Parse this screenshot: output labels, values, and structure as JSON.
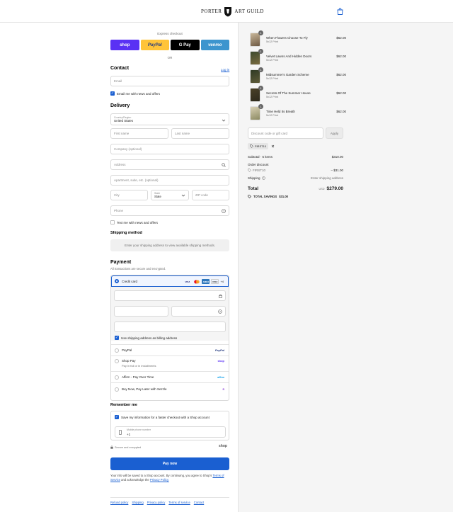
{
  "header": {
    "brand_left": "PORTER",
    "brand_right": "ART GUILD"
  },
  "express": {
    "label": "Express checkout",
    "buttons": [
      "shop",
      "PayPal",
      "G Pay",
      "venmo"
    ],
    "or": "OR"
  },
  "contact": {
    "title": "Contact",
    "login": "Log in",
    "email_placeholder": "Email",
    "newsletter": "Email me with news and offers"
  },
  "delivery": {
    "title": "Delivery",
    "country_label": "Country/Region",
    "country_value": "United States",
    "first_name": "First name",
    "last_name": "Last name",
    "company": "Company (optional)",
    "address": "Address",
    "apartment": "Apartment, suite, etc. (optional)",
    "city": "City",
    "state_label": "State",
    "state_value": "State",
    "zip": "ZIP code",
    "phone": "Phone",
    "text_me": "Text me with news and offers"
  },
  "shipping_method": {
    "title": "Shipping method",
    "placeholder": "Enter your shipping address to view available shipping methods."
  },
  "payment": {
    "title": "Payment",
    "subtitle": "All transactions are secure and encrypted.",
    "credit_card": "Credit card",
    "more_cards": "+4",
    "billing_same": "Use shipping address as billing address",
    "methods": [
      {
        "label": "PayPal",
        "sub": "",
        "logo": "PayPal"
      },
      {
        "label": "Shop Pay",
        "sub": "Pay in full or in installments",
        "logo": "shop"
      },
      {
        "label": "Affirm - Pay Over Time",
        "sub": "",
        "logo": "affirm"
      },
      {
        "label": "Buy Now, Pay Later with Sezzle",
        "sub": "",
        "logo": "S"
      }
    ]
  },
  "remember": {
    "title": "Remember me",
    "save": "Save my information for a faster checkout with a Shop account",
    "phone_label": "Mobile phone number",
    "phone_prefix": "+1",
    "secure": "Secure and encrypted",
    "shop_logo": "shop"
  },
  "pay_now": "Pay now",
  "legal": {
    "text": "Your info will be saved to a Shop account. By continuing, you agree to Shop's",
    "terms": "Terms of Service",
    "and": "and acknowledge the",
    "privacy": "Privacy Policy."
  },
  "footer_links": [
    "Refund policy",
    "Shipping",
    "Privacy policy",
    "Terms of service",
    "Contact"
  ],
  "cart": {
    "items": [
      {
        "name": "When Flowers Choose To Fly",
        "variant": "5x12 Print",
        "price": "$62.00",
        "qty": "1"
      },
      {
        "name": "Velvet Lawns And Hidden Doors",
        "variant": "5x12 Print",
        "price": "$62.00",
        "qty": "1"
      },
      {
        "name": "Midsummer's Garden Scheme",
        "variant": "5x12 Print",
        "price": "$62.00",
        "qty": "1"
      },
      {
        "name": "Secrets Of The Summer House",
        "variant": "5x12 Print",
        "price": "$62.00",
        "qty": "1"
      },
      {
        "name": "Time Held Its Breath",
        "variant": "5x12 Print",
        "price": "$62.00",
        "qty": "1"
      }
    ],
    "discount_placeholder": "Discount code or gift card",
    "apply": "Apply",
    "code_tag": "FIRST10",
    "subtotal_label": "Subtotal · 5 items",
    "subtotal": "$310.00",
    "order_discount": "Order discount",
    "discount_code": "FIRST10",
    "discount_amount": "– $31.00",
    "shipping_label": "Shipping",
    "shipping_value": "Enter shipping address",
    "total_label": "Total",
    "currency": "USD",
    "total": "$279.00",
    "savings_label": "TOTAL SAVINGS",
    "savings": "$31.00"
  }
}
